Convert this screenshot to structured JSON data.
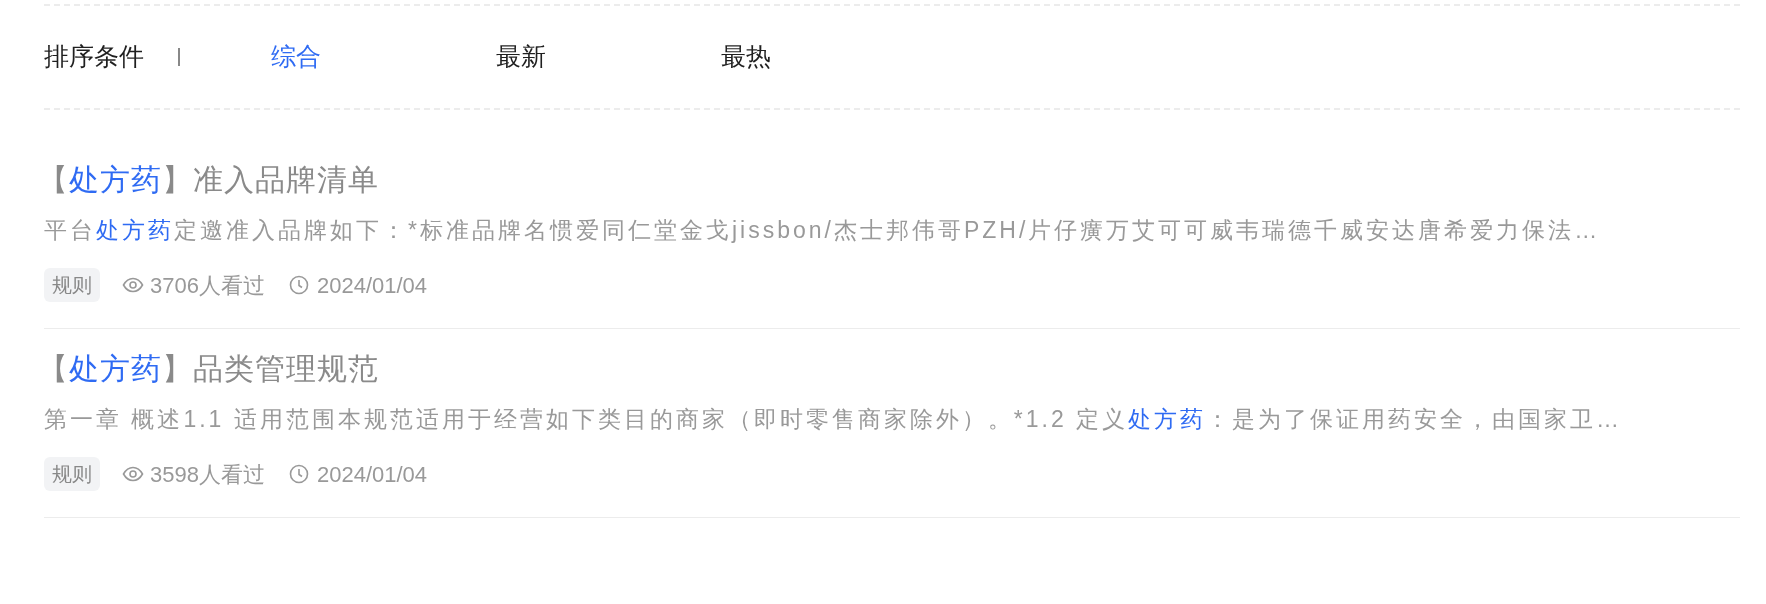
{
  "sort": {
    "label": "排序条件",
    "options": [
      {
        "label": "综合",
        "selected": true
      },
      {
        "label": "最新",
        "selected": false
      },
      {
        "label": "最热",
        "selected": false
      }
    ]
  },
  "articles": [
    {
      "title": [
        {
          "text": "【",
          "highlight": false
        },
        {
          "text": "处方药",
          "highlight": true
        },
        {
          "text": "】准入品牌清单",
          "highlight": false
        }
      ],
      "summary": [
        {
          "text": "平台",
          "highlight": false
        },
        {
          "text": "处方药",
          "highlight": true
        },
        {
          "text": "定邀准入品牌如下：*标准品牌名惯爱同仁堂金戈jissbon/杰士邦伟哥PZH/片仔癀万艾可可威韦瑞德千威安达唐希爱力保法…",
          "highlight": false
        }
      ],
      "tag": "规则",
      "views": "3706人看过",
      "date": "2024/01/04"
    },
    {
      "title": [
        {
          "text": "【",
          "highlight": false
        },
        {
          "text": "处方药",
          "highlight": true
        },
        {
          "text": "】品类管理规范",
          "highlight": false
        }
      ],
      "summary": [
        {
          "text": "第一章 概述1.1 适用范围本规范适用于经营如下类目的商家（即时零售商家除外）。*1.2 定义",
          "highlight": false
        },
        {
          "text": "处方药",
          "highlight": true
        },
        {
          "text": "：是为了保证用药安全，由国家卫…",
          "highlight": false
        }
      ],
      "tag": "规则",
      "views": "3598人看过",
      "date": "2024/01/04"
    }
  ]
}
